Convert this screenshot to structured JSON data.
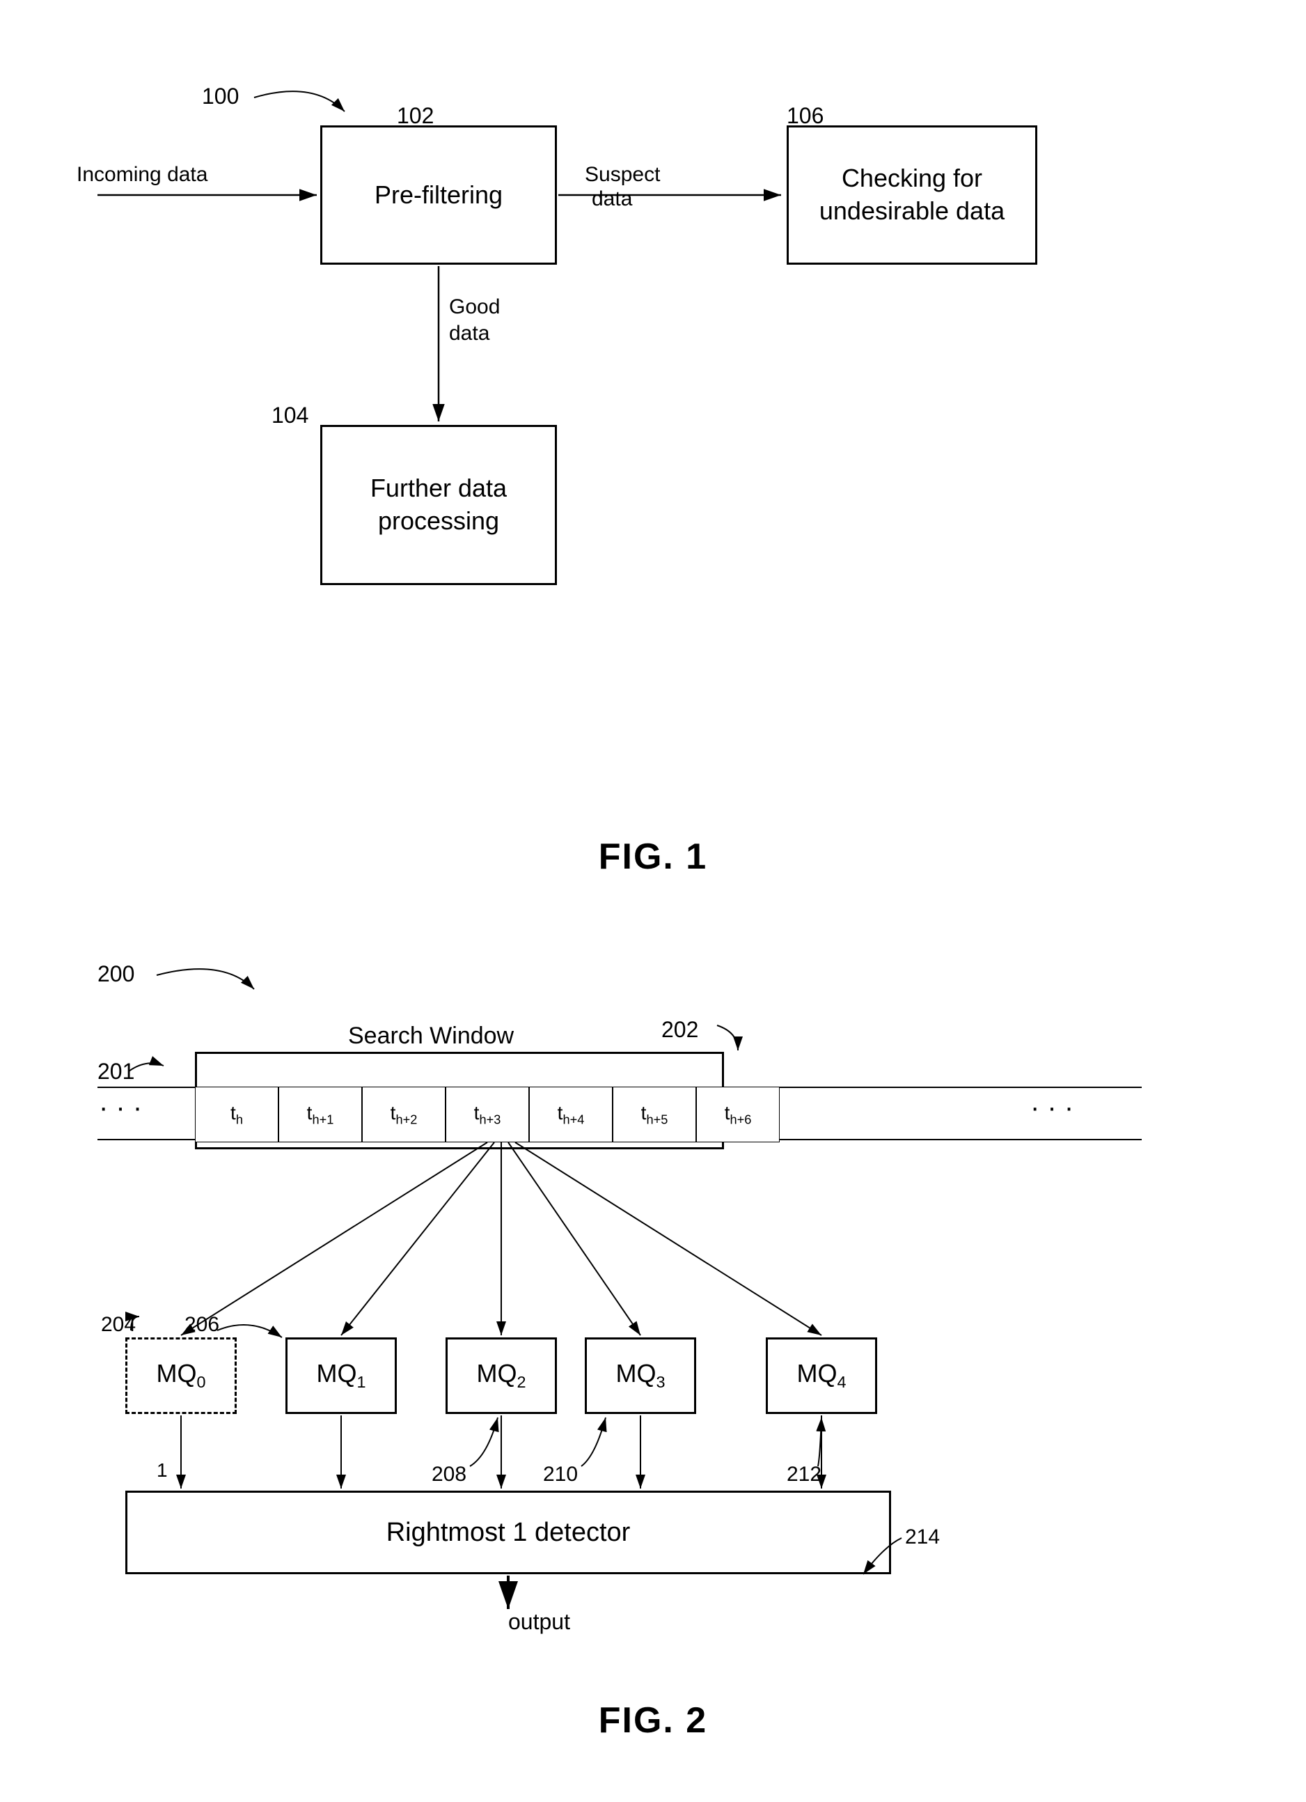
{
  "fig1": {
    "label": "FIG. 1",
    "ref_100": "100",
    "ref_102": "102",
    "ref_104": "104",
    "ref_106": "106",
    "box_prefilter": "Pre-filtering",
    "box_checking": "Checking for\nundesirable data",
    "box_further": "Further data\nprocessing",
    "arrow_incoming": "Incoming data",
    "arrow_suspect": "Suspect\ndata",
    "arrow_good": "Good\ndata"
  },
  "fig2": {
    "label": "FIG. 2",
    "ref_200": "200",
    "ref_201": "201",
    "ref_202": "202",
    "ref_204": "204",
    "ref_206": "206",
    "ref_208": "208",
    "ref_210": "210",
    "ref_212": "212",
    "ref_214": "214",
    "search_window_label": "Search Window",
    "mq0_label": "MQ₀",
    "mq1_label": "MQ₁",
    "mq2_label": "MQ₂",
    "mq3_label": "MQ₃",
    "mq4_label": "MQ₄",
    "rightmost_label": "Rightmost 1 detector",
    "output_label": "output",
    "label_1": "1",
    "cells": [
      "t_h",
      "t_{h+1}",
      "t_{h+2}",
      "t_{h+3}",
      "t_{h+4}",
      "t_{h+5}",
      "t_{h+6}"
    ]
  }
}
